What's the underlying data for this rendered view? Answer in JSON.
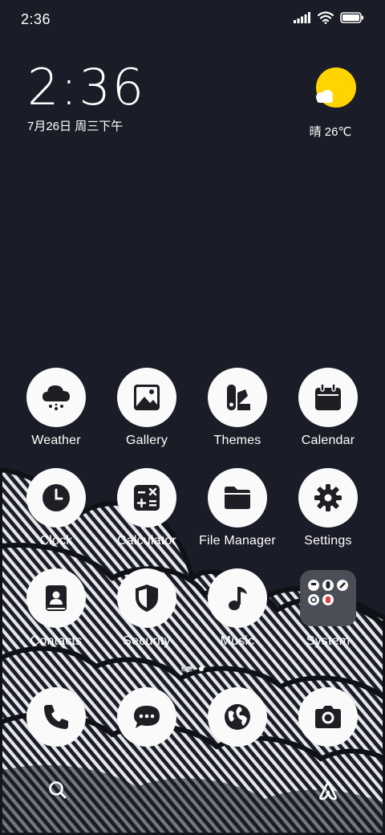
{
  "status_bar": {
    "time": "2:36",
    "icons": [
      "signal-icon",
      "wifi-icon",
      "battery-icon"
    ]
  },
  "clock_widget": {
    "time": "2:36",
    "date": "7月26日 周三下午"
  },
  "weather_widget": {
    "icon": "sun-cloud-icon",
    "text": "晴 26℃",
    "sun_color": "#ffd400"
  },
  "apps": [
    {
      "label": "Weather",
      "icon": "weather-icon"
    },
    {
      "label": "Gallery",
      "icon": "gallery-icon"
    },
    {
      "label": "Themes",
      "icon": "themes-icon"
    },
    {
      "label": "Calendar",
      "icon": "calendar-icon"
    },
    {
      "label": "Clock",
      "icon": "clock-icon"
    },
    {
      "label": "Calculator",
      "icon": "calculator-icon"
    },
    {
      "label": "File Manager",
      "icon": "folder-icon"
    },
    {
      "label": "Settings",
      "icon": "gear-icon"
    },
    {
      "label": "Contacts",
      "icon": "contacts-icon"
    },
    {
      "label": "Security",
      "icon": "shield-icon"
    },
    {
      "label": "Music",
      "icon": "music-icon"
    },
    {
      "label": "System",
      "icon": "folder-system-icon"
    }
  ],
  "dock": [
    {
      "icon": "phone-icon"
    },
    {
      "icon": "messages-icon"
    },
    {
      "icon": "browser-icon"
    },
    {
      "icon": "camera-icon"
    }
  ],
  "bottom_bar": {
    "left": "search-icon",
    "right": "assistant-icon"
  },
  "colors": {
    "background": "#1a1d27",
    "icon_bg": "#fafafa",
    "icon_glyph": "#1e1f24",
    "accent_sun": "#ffd400"
  }
}
